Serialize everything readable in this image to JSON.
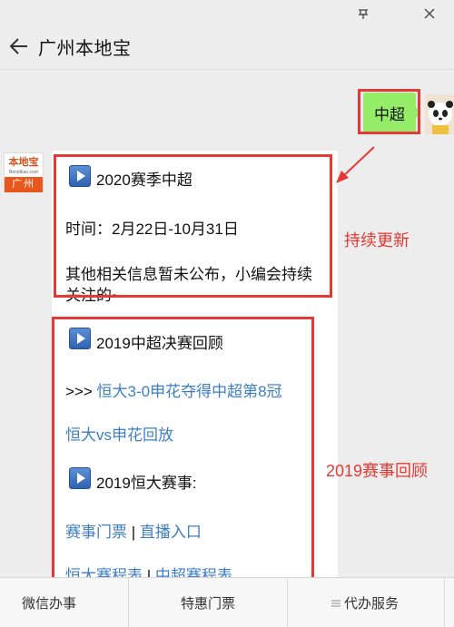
{
  "header": {
    "title": "广州本地宝"
  },
  "my_message": {
    "text": "中超"
  },
  "bot_avatar": {
    "top_text": "本地宝",
    "sub_text": "Bendibao.com",
    "bottom_text": "广州"
  },
  "card": {
    "section1": {
      "title": "2020赛季中超",
      "time": "时间：2月22日-10月31日",
      "note_line1": "其他相关信息暂未公布，小编会持续",
      "note_line2": "关注的~"
    },
    "section2": {
      "title": "2019中超决赛回顾",
      "prefix": ">>> ",
      "link1": "恒大3-0申花夺得中超第8冠",
      "link2": "恒大vs申花回放"
    },
    "section3": {
      "title": "2019恒大赛事:",
      "link_tickets": "赛事门票",
      "link_live": "直播入口",
      "link_schedule1": "恒大赛程表",
      "link_schedule2": "中超赛程表",
      "separator": " | "
    }
  },
  "annotations": {
    "updating": "持续更新",
    "review": "2019赛事回顾"
  },
  "bottom_menu": [
    "微信办事",
    "特惠门票",
    "代办服务"
  ],
  "colors": {
    "bubble": "#95ec69",
    "link": "#3d7ec4",
    "annotation": "#e53935"
  }
}
